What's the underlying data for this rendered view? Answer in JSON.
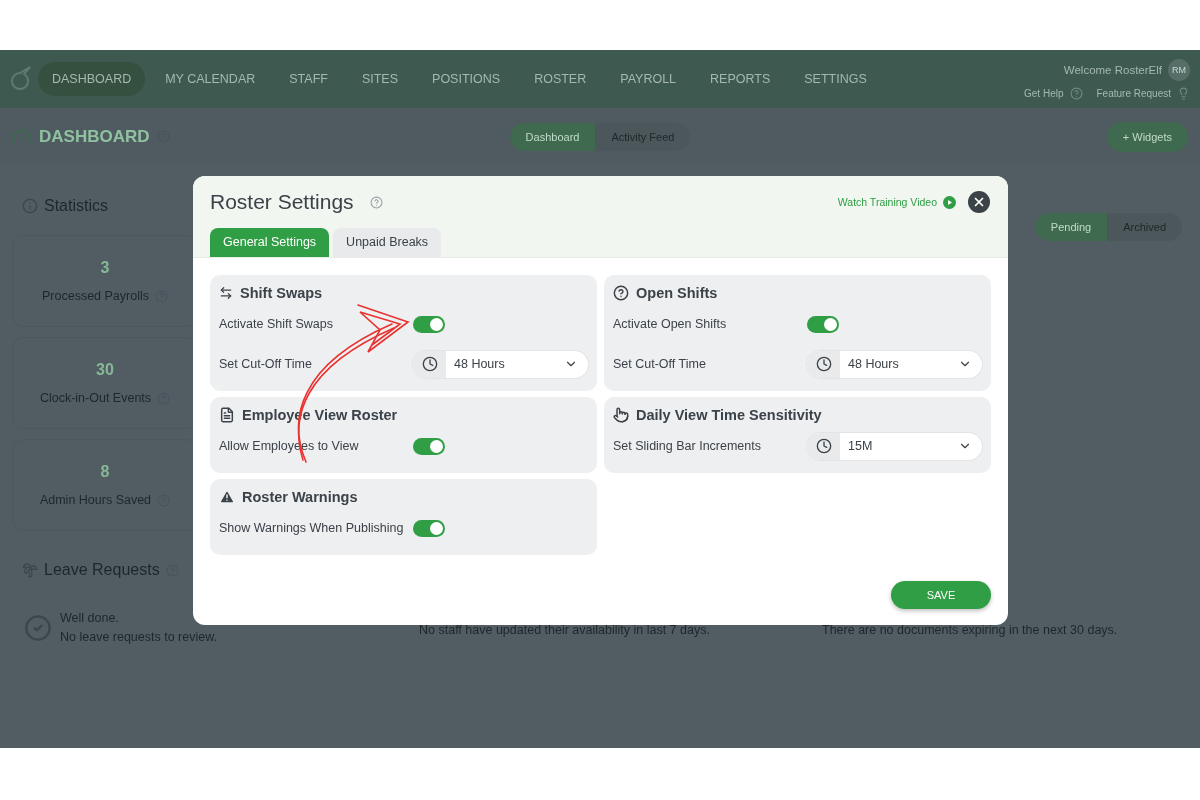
{
  "nav": {
    "items": [
      {
        "label": "DASHBOARD",
        "selected": true
      },
      {
        "label": "MY CALENDAR",
        "selected": false
      },
      {
        "label": "STAFF",
        "selected": false
      },
      {
        "label": "SITES",
        "selected": false
      },
      {
        "label": "POSITIONS",
        "selected": false
      },
      {
        "label": "ROSTER",
        "selected": false
      },
      {
        "label": "PAYROLL",
        "selected": false
      },
      {
        "label": "REPORTS",
        "selected": false
      },
      {
        "label": "SETTINGS",
        "selected": false
      }
    ],
    "welcome": "Welcome RosterElf",
    "avatar": "RM",
    "help": "Get Help",
    "feature": "Feature Request"
  },
  "subheader": {
    "title": "DASHBOARD",
    "tabs": [
      {
        "label": "Dashboard",
        "selected": true
      },
      {
        "label": "Activity Feed",
        "selected": false
      }
    ],
    "widgets_button": "+ Widgets"
  },
  "statistics": {
    "title": "Statistics",
    "items": [
      {
        "value": "3",
        "label": "Processed Payrolls"
      },
      {
        "value": "30",
        "label": "Clock-in-Out Events"
      },
      {
        "value": "8",
        "label": "Admin Hours Saved"
      }
    ]
  },
  "leave_requests": {
    "title": "Leave Requests",
    "message": [
      "Well done.",
      "No leave requests to review."
    ]
  },
  "availability": {
    "message": "No staff have updated their availability in last 7 days."
  },
  "documents": {
    "tabs": [
      {
        "label": "Pending",
        "selected": true
      },
      {
        "label": "Archived",
        "selected": false
      }
    ],
    "message": "There are no documents expiring in the next 30 days."
  },
  "modal": {
    "title": "Roster Settings",
    "watch_video": "Watch Training Video",
    "tabs": [
      {
        "label": "General Settings",
        "selected": true
      },
      {
        "label": "Unpaid Breaks",
        "selected": false
      }
    ],
    "sections": [
      {
        "title": "Shift Swaps",
        "rows": [
          {
            "kind": "toggle",
            "label": "Activate Shift Swaps",
            "on": true
          },
          {
            "kind": "select",
            "label": "Set Cut-Off Time",
            "value": "48 Hours"
          }
        ]
      },
      {
        "title": "Open Shifts",
        "rows": [
          {
            "kind": "toggle",
            "label": "Activate Open Shifts",
            "on": true
          },
          {
            "kind": "select",
            "label": "Set Cut-Off Time",
            "value": "48 Hours"
          }
        ]
      },
      {
        "title": "Employee View Roster",
        "rows": [
          {
            "kind": "toggle",
            "label": "Allow Employees to View",
            "on": true
          }
        ]
      },
      {
        "title": "Daily View Time Sensitivity",
        "rows": [
          {
            "kind": "select",
            "label": "Set Sliding Bar Increments",
            "value": "15M"
          }
        ]
      },
      {
        "title": "Roster Warnings",
        "rows": [
          {
            "kind": "toggle",
            "label": "Show Warnings When Publishing",
            "on": true
          }
        ]
      }
    ],
    "save": "SAVE"
  }
}
